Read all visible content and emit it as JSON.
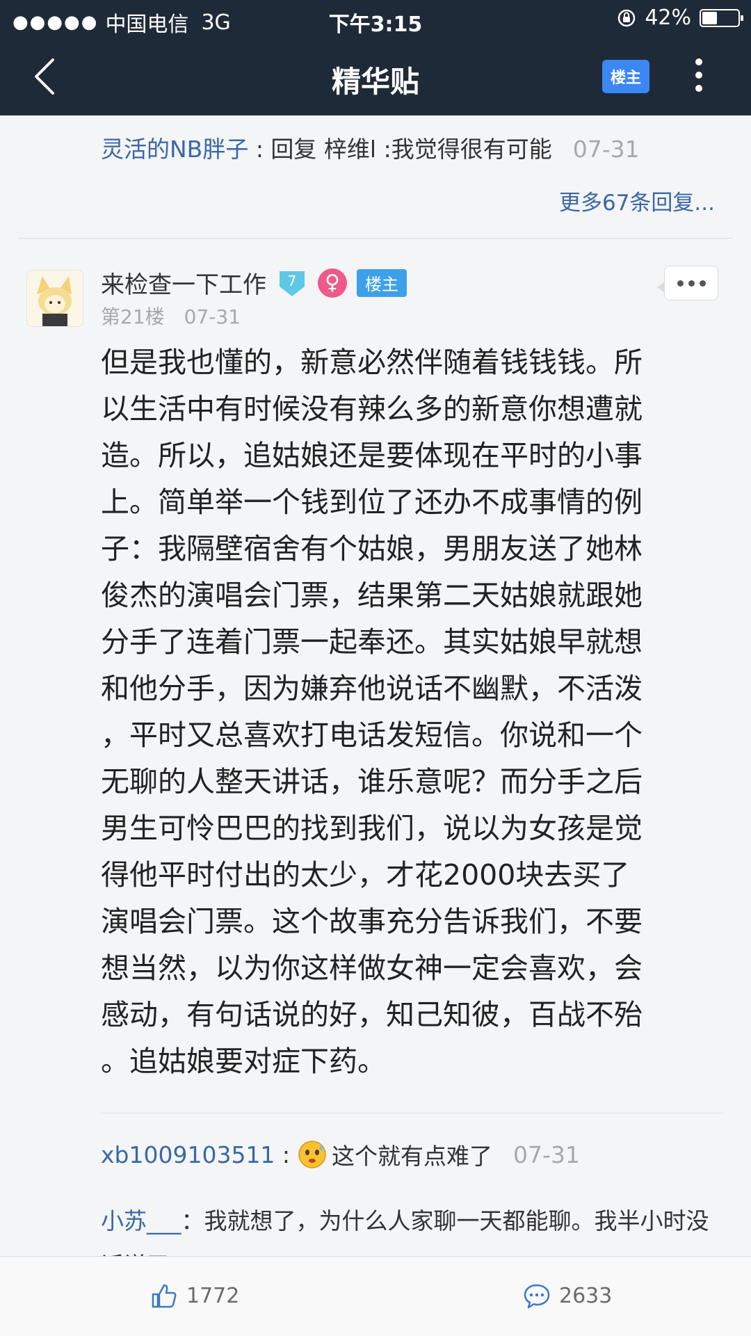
{
  "status_bar": {
    "carrier": "中国电信",
    "network": "3G",
    "time": "下午3:15",
    "battery": "42%",
    "battery_level": 0.42
  },
  "nav": {
    "title": "精华贴",
    "owner_button": "楼主"
  },
  "prev_reply": {
    "author": "灵活的NB胖子",
    "text": " : 回复 梓维l :我觉得很有可能",
    "date": "07-31"
  },
  "more_replies": "更多67条回复...",
  "post": {
    "username": "来检查一下工作",
    "level": "7",
    "gender_symbol": "♀",
    "owner_tag": "楼主",
    "floor": "第21楼",
    "date": "07-31",
    "body_lines": [
      "但是我也懂的，新意必然伴随着钱钱钱。所",
      "以生活中有时候没有辣么多的新意你想遭就",
      "造。所以，追姑娘还是要体现在平时的小事",
      "上。简单举一个钱到位了还办不成事情的例",
      "子：我隔壁宿舍有个姑娘，男朋友送了她林",
      "俊杰的演唱会门票，结果第二天姑娘就跟她",
      "分手了连着门票一起奉还。其实姑娘早就想",
      "和他分手，因为嫌弃他说话不幽默，不活泼",
      "，平时又总喜欢打电话发短信。你说和一个",
      "无聊的人整天讲话，谁乐意呢？而分手之后",
      "男生可怜巴巴的找到我们，说以为女孩是觉",
      "得他平时付出的太少，才花2000块去买了",
      "演唱会门票。这个故事充分告诉我们，不要",
      "想当然，以为你这样做女神一定会喜欢，会",
      "感动，有句话说的好，知己知彼，百战不殆",
      "。追姑娘要对症下药。"
    ]
  },
  "sub_replies": [
    {
      "author": "xb1009103511",
      "text": "这个就有点难了",
      "date": "07-31",
      "emoji": "sweat-face-icon"
    },
    {
      "author": "小苏___",
      "text": "：我就想了，为什么人家聊一天都能聊。我半小时没话说了",
      "date": "07-31"
    }
  ],
  "bottom_bar": {
    "likes": "1772",
    "comments": "2633"
  },
  "colors": {
    "nav_bg": "#1f2a38",
    "link": "#3a67a6",
    "owner_blue": "#3b88f5",
    "gender_pink": "#ee5a8a"
  }
}
